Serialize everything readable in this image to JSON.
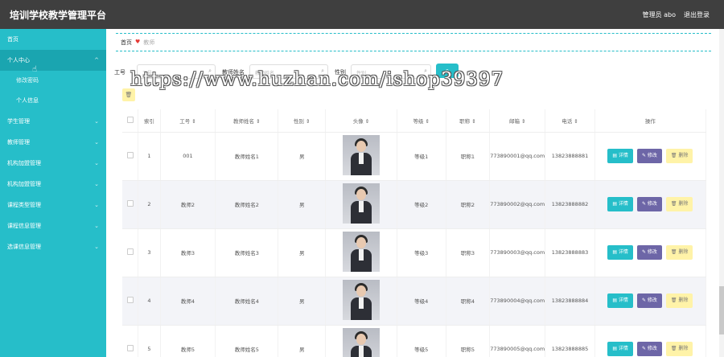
{
  "app": {
    "title": "培训学校教学管理平台",
    "admin_label": "管理员 abo",
    "logout_label": "退出登录"
  },
  "sidebar": {
    "items": [
      {
        "label": "首页",
        "chevron": ""
      },
      {
        "label": "个人中心",
        "chevron": "^"
      },
      {
        "label": "学生管理",
        "chevron": "⌄"
      },
      {
        "label": "教师管理",
        "chevron": "⌄"
      },
      {
        "label": "机构加盟管理",
        "chevron": "⌄"
      },
      {
        "label": "机构加盟管理",
        "chevron": "⌄"
      },
      {
        "label": "课程类型管理",
        "chevron": "⌄"
      },
      {
        "label": "课程信息管理",
        "chevron": "⌄"
      },
      {
        "label": "选课信息管理",
        "chevron": "⌄"
      }
    ],
    "sub_items": [
      {
        "label": "修改密码"
      },
      {
        "label": "个人信息"
      }
    ]
  },
  "breadcrumb": {
    "home": "首页",
    "current": "教师"
  },
  "search": {
    "field1_label": "工号",
    "field1_placeholder": "工号",
    "field2_label": "教师姓名",
    "field2_placeholder": "教师姓名",
    "field3_label": "性别",
    "field3_placeholder": "性别",
    "button_icon": "search-icon",
    "delete_icon": "trash-icon"
  },
  "watermark": "https://www.huzhan.com/ishop39397",
  "table": {
    "headers": [
      "索引",
      "工号 ⇕",
      "教师姓名 ⇕",
      "性别 ⇕",
      "头像 ⇕",
      "等级 ⇕",
      "职称 ⇕",
      "邮箱 ⇕",
      "电话 ⇕",
      "操作"
    ],
    "actions": {
      "detail": "详情",
      "edit": "修改",
      "remove": "删除"
    },
    "rows": [
      {
        "index": "1",
        "no": "001",
        "name": "教师姓名1",
        "gender": "男",
        "level": "等级1",
        "title": "职称1",
        "email": "773890001@qq.com",
        "phone": "13823888881"
      },
      {
        "index": "2",
        "no": "教师2",
        "name": "教师姓名2",
        "gender": "男",
        "level": "等级2",
        "title": "职称2",
        "email": "773890002@qq.com",
        "phone": "13823888882"
      },
      {
        "index": "3",
        "no": "教师3",
        "name": "教师姓名3",
        "gender": "男",
        "level": "等级3",
        "title": "职称3",
        "email": "773890003@qq.com",
        "phone": "13823888883"
      },
      {
        "index": "4",
        "no": "教师4",
        "name": "教师姓名4",
        "gender": "男",
        "level": "等级4",
        "title": "职称4",
        "email": "773890004@qq.com",
        "phone": "13823888884"
      },
      {
        "index": "5",
        "no": "教师5",
        "name": "教师姓名5",
        "gender": "男",
        "level": "等级5",
        "title": "职称5",
        "email": "773890005@qq.com",
        "phone": "13823888885"
      }
    ]
  },
  "colors": {
    "accent": "#26bec9",
    "topbar": "#3f3f3f",
    "edit_button": "#6d66a7",
    "delete_button": "#fff3a8"
  }
}
